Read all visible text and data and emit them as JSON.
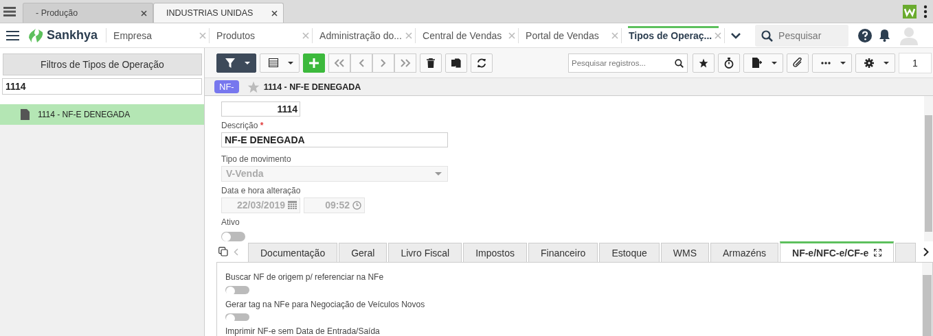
{
  "browser_tabs": [
    {
      "label": "- Produção",
      "selected": false
    },
    {
      "label": "INDUSTRIAS UNIDAS",
      "selected": true
    }
  ],
  "header": {
    "logo": "Sankhya",
    "app_tabs": [
      {
        "label": "Empresa",
        "selected": false
      },
      {
        "label": "Produtos",
        "selected": false
      },
      {
        "label": "Administração do...",
        "selected": false
      },
      {
        "label": "Central de Vendas",
        "selected": false
      },
      {
        "label": "Portal de Vendas",
        "selected": false
      },
      {
        "label": "Tipos de Operaç...",
        "selected": true
      }
    ],
    "search": {
      "placeholder": "Pesquisar"
    }
  },
  "sidebar": {
    "title": "Filtros de Tipos de Operação",
    "filter_value": "1114",
    "items": [
      {
        "label": "1114 - NF-E DENEGADA",
        "selected": true
      }
    ]
  },
  "toolbar": {
    "search": {
      "placeholder": "Pesquisar registros..."
    },
    "page": "1"
  },
  "record": {
    "badge": "NF-",
    "title": "1114 - NF-E DENEGADA",
    "favorite": false
  },
  "form": {
    "code_value": "1114",
    "description_label": "Descrição",
    "required_mark": "*",
    "description_value": "NF-E DENEGADA",
    "movement_label": "Tipo de movimento",
    "movement_value": "V-Venda",
    "movement_disabled": true,
    "date_label": "Data e hora alteração",
    "date_value": "22/03/2019",
    "time_value": "09:52",
    "active_label": "Ativo",
    "active_on": false
  },
  "detail_tabs": [
    {
      "label": "Documentação",
      "selected": false
    },
    {
      "label": "Geral",
      "selected": false
    },
    {
      "label": "Livro Fiscal",
      "selected": false
    },
    {
      "label": "Impostos",
      "selected": false
    },
    {
      "label": "Financeiro",
      "selected": false
    },
    {
      "label": "Estoque",
      "selected": false
    },
    {
      "label": "WMS",
      "selected": false
    },
    {
      "label": "Armazéns",
      "selected": false
    },
    {
      "label": "NF-e/NFC-e/CF-e",
      "selected": true
    }
  ],
  "options": [
    {
      "label": "Buscar NF de origem p/ referenciar na NFe",
      "on": false
    },
    {
      "label": "Gerar tag na NFe para Negociação de Veículos Novos",
      "on": false
    },
    {
      "label": "Imprimir NF-e sem Data de Entrada/Saída"
    }
  ]
}
